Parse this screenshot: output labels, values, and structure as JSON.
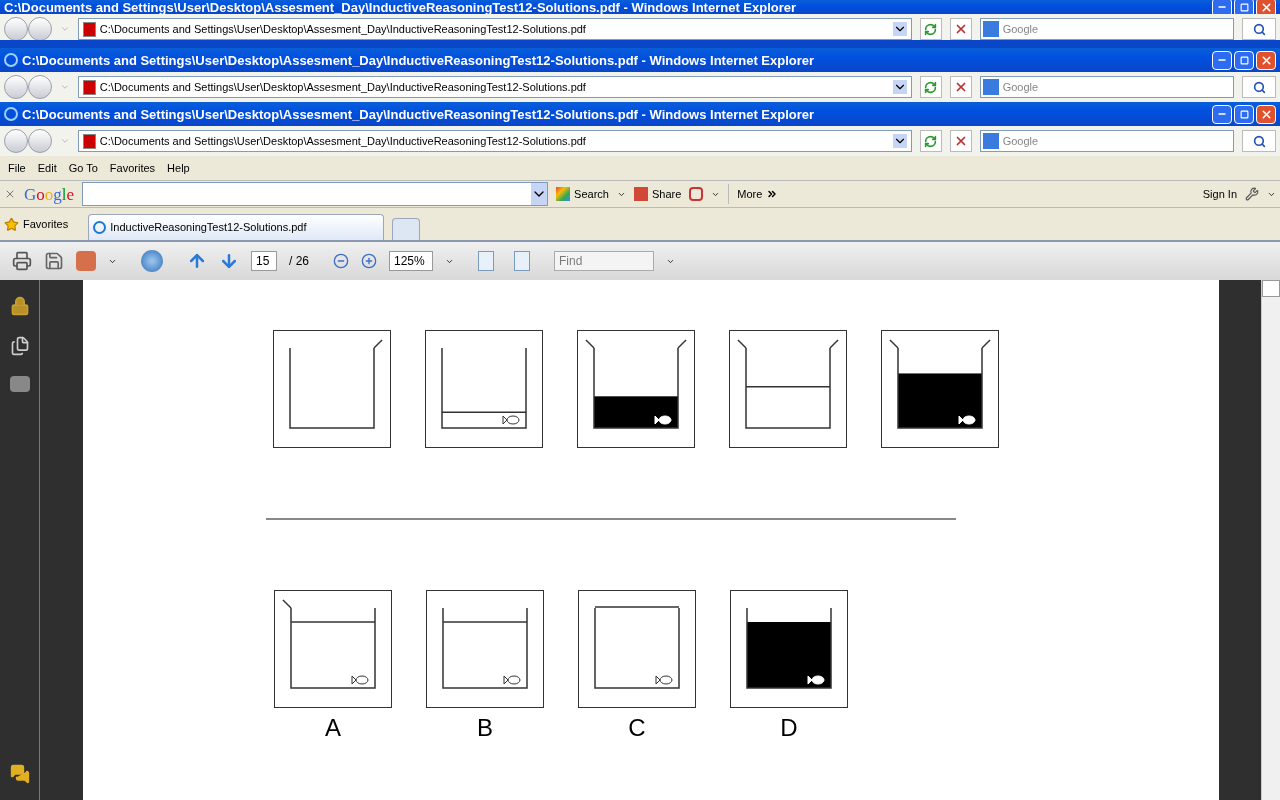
{
  "windows": [
    {
      "title": "C:\\Documents and Settings\\User\\Desktop\\Assesment_Day\\InductiveReasoningTest12-Solutions.pdf - Windows Internet Explorer",
      "address": "C:\\Documents and Settings\\User\\Desktop\\Assesment_Day\\InductiveReasoningTest12-Solutions.pdf",
      "search_placeholder": "Google"
    },
    {
      "title": "C:\\Documents and Settings\\User\\Desktop\\Assesment_Day\\InductiveReasoningTest12-Solutions.pdf - Windows Internet Explorer",
      "address": "C:\\Documents and Settings\\User\\Desktop\\Assesment_Day\\InductiveReasoningTest12-Solutions.pdf",
      "search_placeholder": "Google"
    },
    {
      "title": "C:\\Documents and Settings\\User\\Desktop\\Assesment_Day\\InductiveReasoningTest12-Solutions.pdf - Windows Internet Explorer",
      "address": "C:\\Documents and Settings\\User\\Desktop\\Assesment_Day\\InductiveReasoningTest12-Solutions.pdf",
      "search_placeholder": "Google"
    }
  ],
  "menu": [
    "File",
    "Edit",
    "Go To",
    "Favorites",
    "Help"
  ],
  "google_bar": {
    "logo": "Google",
    "search": "Search",
    "share": "Share",
    "more": "More",
    "sign_in": "Sign In"
  },
  "favorites": "Favorites",
  "tabs": [
    {
      "label": "InductiveReasoningTest12-Solutions.pdf",
      "selected": true
    }
  ],
  "pdf_toolbar": {
    "page": "15",
    "total": "/ 26",
    "zoom": "125%",
    "find_placeholder": "Find"
  },
  "sequence": [
    {
      "kind": "empty"
    },
    {
      "kind": "line"
    },
    {
      "kind": "filled"
    },
    {
      "kind": "line"
    },
    {
      "kind": "filled"
    }
  ],
  "options": [
    {
      "label": "A",
      "kind": "line"
    },
    {
      "label": "B",
      "kind": "line"
    },
    {
      "label": "C",
      "kind": "line"
    },
    {
      "label": "D",
      "kind": "filled"
    }
  ]
}
